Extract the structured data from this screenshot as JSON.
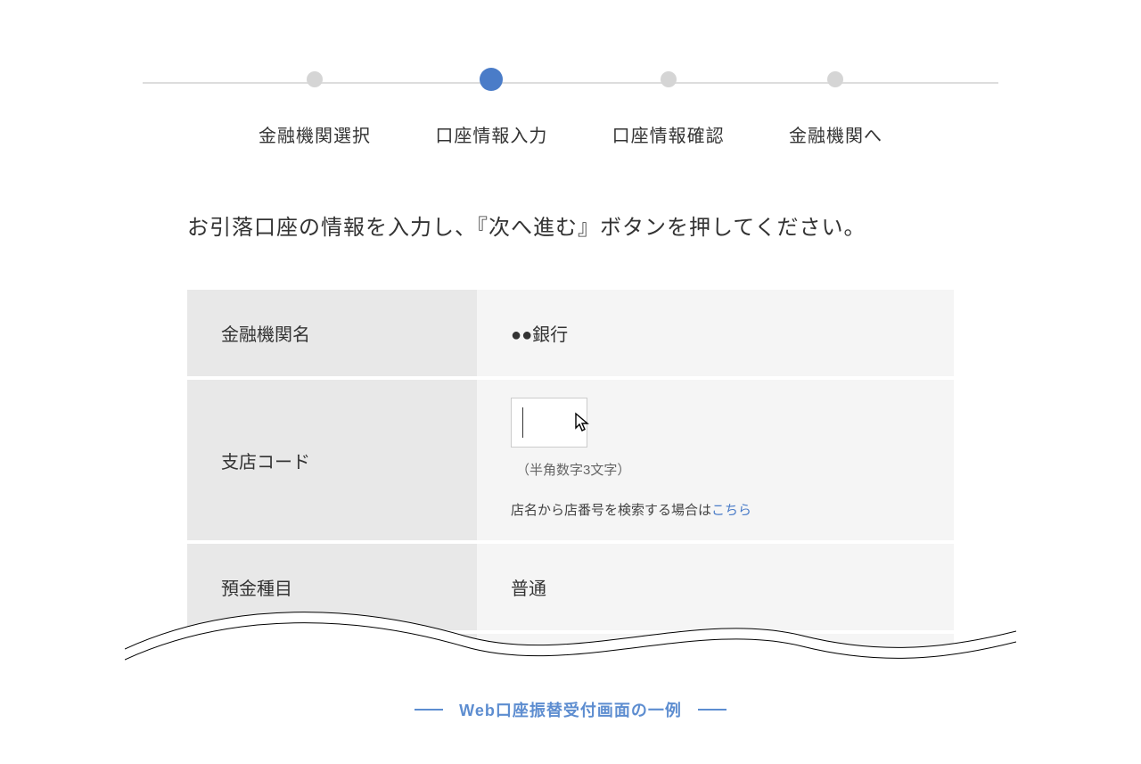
{
  "stepper": {
    "steps": [
      {
        "label": "金融機関選択",
        "active": false
      },
      {
        "label": "口座情報入力",
        "active": true
      },
      {
        "label": "口座情報確認",
        "active": false
      },
      {
        "label": "金融機関へ",
        "active": false
      }
    ]
  },
  "instruction": "お引落口座の情報を入力し、『次へ進む』ボタンを押してください。",
  "form": {
    "bank_name": {
      "label": "金融機関名",
      "value": "●●銀行"
    },
    "branch_code": {
      "label": "支店コード",
      "value": "",
      "hint": "（半角数字3文字）",
      "search_prefix": "店名から店番号を検索する場合は",
      "search_link": "こちら"
    },
    "account_type": {
      "label": "預金種目",
      "value": "普通"
    }
  },
  "caption": "Web口座振替受付画面の一例"
}
